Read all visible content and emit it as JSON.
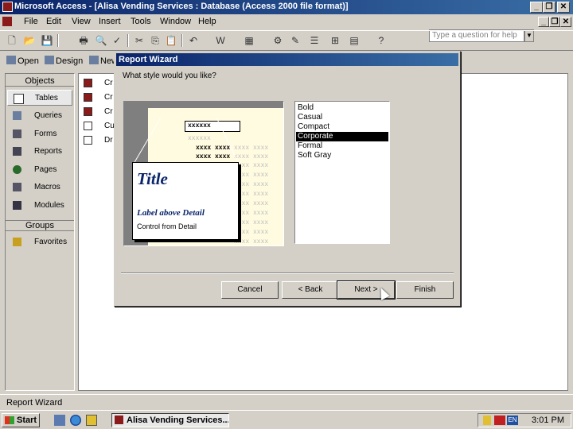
{
  "app": {
    "title": "Microsoft Access - [Alisa Vending Services : Database (Access 2000 file format)]"
  },
  "window_controls": {
    "minimize": "_",
    "restore": "❐",
    "close": "✕"
  },
  "menu": {
    "items": [
      "File",
      "Edit",
      "View",
      "Insert",
      "Tools",
      "Window",
      "Help"
    ],
    "help_placeholder": "Type a question for help",
    "doc_minimize": "_",
    "doc_restore": "❐",
    "doc_close": "✕"
  },
  "toolbar": {
    "icons": [
      "new-icon",
      "open-icon",
      "save-icon",
      "print-icon",
      "print-preview-icon",
      "spelling-icon",
      "cut-icon",
      "copy-icon",
      "paste-icon",
      "undo-icon",
      "office-links-icon",
      "analyze-icon",
      "code-icon",
      "properties-icon",
      "relationships-icon",
      "new-object-icon",
      "help-icon"
    ]
  },
  "db_window": {
    "buttons": {
      "open": "Open",
      "design": "Design",
      "new": "New"
    },
    "objects_header": "Objects",
    "groups_header": "Groups",
    "objects": [
      "Tables",
      "Queries",
      "Forms",
      "Reports",
      "Pages",
      "Macros",
      "Modules"
    ],
    "groups": [
      "Favorites"
    ],
    "list": [
      "Cr",
      "Cr",
      "Cr",
      "Cu",
      "Dr"
    ]
  },
  "wizard": {
    "title": "Report Wizard",
    "question": "What style would you like?",
    "styles": [
      "Bold",
      "Casual",
      "Compact",
      "Corporate",
      "Formal",
      "Soft Gray"
    ],
    "selected_style": "Corporate",
    "preview": {
      "title": "Title",
      "label": "Label above Detail",
      "control": "Control from Detail",
      "header_x": "xxxxxx",
      "row_x": "xxxx xxxx",
      "light_x": "xxxx xxxx xxxx xxxx"
    },
    "buttons": {
      "cancel": "Cancel",
      "back": "< Back",
      "next": "Next >",
      "finish": "Finish"
    }
  },
  "status": {
    "text": "Report Wizard"
  },
  "taskbar": {
    "start": "Start",
    "task": "Alisa Vending Services...",
    "tray_lang": "EN",
    "clock": "3:01 PM"
  }
}
